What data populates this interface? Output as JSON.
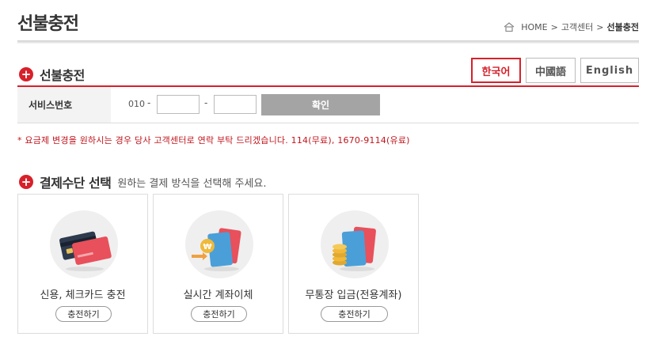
{
  "page": {
    "title": "선불충전"
  },
  "breadcrumb": {
    "home": "HOME",
    "sep": ">",
    "level1": "고객센터",
    "sep2": ">",
    "current": "선불충전"
  },
  "prepaid_section": {
    "title": "선불충전"
  },
  "languages": [
    {
      "label": "한국어",
      "active": true
    },
    {
      "label": "中國語",
      "active": false
    },
    {
      "label": "English",
      "active": false
    }
  ],
  "service_number": {
    "label": "서비스번호",
    "prefix": "010",
    "dash1": "-",
    "dash2": "-",
    "part1_value": "",
    "part2_value": "",
    "confirm_label": "확인"
  },
  "notice": "* 요금제 변경을 원하시는 경우 당사 고객센터로 연락 부탁 드리겠습니다. 114(무료), 1670-9114(유료)",
  "payment_section": {
    "title": "결제수단 선택",
    "subtitle": "원하는 결제 방식을 선택해 주세요."
  },
  "payment_methods": [
    {
      "label": "신용, 체크카드 충전",
      "button": "충전하기",
      "icon": "credit-card-icon"
    },
    {
      "label": "실시간 계좌이체",
      "button": "충전하기",
      "icon": "bank-transfer-icon"
    },
    {
      "label": "무통장 입금(전용계좌)",
      "button": "충전하기",
      "icon": "bankbook-deposit-icon"
    }
  ],
  "colors": {
    "accent": "#d8202a",
    "notice": "#c0151c",
    "confirm_bg": "#a4a4a4"
  }
}
